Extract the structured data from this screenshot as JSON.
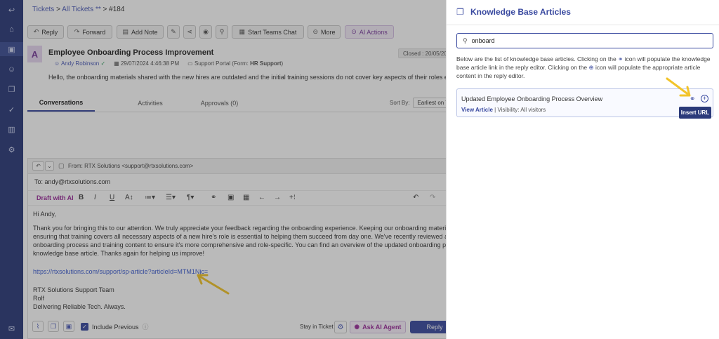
{
  "nav": {
    "icons": [
      "logout-icon",
      "home-icon",
      "ticket-icon",
      "contacts-icon",
      "knowledge-icon",
      "tasks-icon",
      "reports-icon",
      "settings-icon",
      "chat-icon"
    ]
  },
  "breadcrumb": {
    "part1": "Tickets",
    "sep1": " > ",
    "part2": "All Tickets **",
    "sep2": " > ",
    "part3": "#184"
  },
  "toolbar": {
    "reply": "Reply",
    "forward": "Forward",
    "add_note": "Add Note",
    "start_teams_chat": "Start Teams Chat",
    "more": "More",
    "ai_actions": "AI Actions"
  },
  "ticket": {
    "avatar_letter": "A",
    "title": "Employee Onboarding Process Improvement",
    "closed": "Closed : 20/05/20",
    "requester": "Andy Robinson",
    "date": "29/07/2024 4:46:38 PM",
    "source_prefix": "Support Portal (Form: ",
    "source_form": "HR Support",
    "source_suffix": ")",
    "preview": "Hello, the onboarding materials shared with the new hires are outdated and the initial training sessions do not cover key aspects of their roles effectively."
  },
  "tabs": {
    "conversations": "Conversations",
    "activities": "Activities",
    "approvals": "Approvals (0)"
  },
  "sort": {
    "label": "Sort By:",
    "value": "Earliest on To"
  },
  "reply_editor": {
    "from": "From: RTX Solutions <support@rtxsolutions.com>",
    "to": "To: andy@rtxsolutions.com",
    "draft_ai": "Draft with AI",
    "greeting": "Hi Andy,",
    "para1_line1": "Thank you for bringing this to our attention. We truly appreciate your feedback regarding the onboarding experience. Keeping our onboarding materials relevant",
    "para1_line2": "ensuring that training covers all necessary aspects of a new hire's role is essential to helping them succeed from day one. We've recently reviewed and update",
    "para1_line3": "onboarding process and training content to ensure it's more comprehensive and role-specific. You can find an overview of the updated onboarding process in th",
    "para1_line4": "knowledge base article. Thanks again for helping us improve!",
    "link": "https://rtxsolutions.com/support/sp-article?articleId=MTM1Njc=",
    "sig1": "RTX Solutions Support Team",
    "sig2": "Rolf",
    "sig3": "Delivering Reliable Tech. Always.",
    "include_previous": "Include Previous",
    "stay_in_ticket": "Stay in Ticket",
    "ask_ai_agent": "Ask AI Agent",
    "reply": "Reply"
  },
  "kb_panel": {
    "title": "Knowledge Base Articles",
    "search_value": "onboard",
    "description_part1": "Below are the list of knowledge base articles. Clicking on the",
    "description_part2": "icon will populate the knowledge base article link in the reply editor. Clicking on the",
    "description_part3": "icon will populate the appropriate article content in the reply editor.",
    "article_title": "Updated Employee Onboarding Process Overview",
    "view_article": "View Article",
    "visibility": " | Visibility: All visitors",
    "tooltip": "Insert URL"
  },
  "colors": {
    "nav": "#2b3a7a",
    "accent": "#3a4aa0",
    "ai": "#9b2d9b",
    "arrow": "#f2c42a"
  }
}
